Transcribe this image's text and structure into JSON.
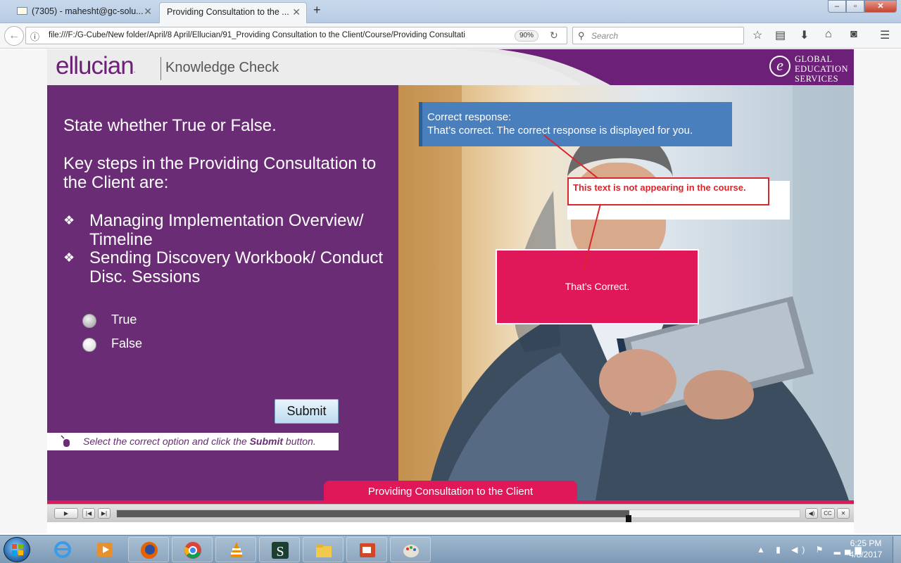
{
  "browser": {
    "tabs": [
      {
        "label": "(7305) - mahesht@gc-solu..."
      },
      {
        "label": "Providing Consultation to the ..."
      }
    ],
    "url": "file:///F:/G-Cube/New folder/April/8 April/Ellucian/91_Providing Consultation to the Client/Course/Providing Consultati",
    "zoom": "90%",
    "search_placeholder": "Search"
  },
  "course": {
    "logo": "ellucian",
    "header_title": "Knowledge Check",
    "partner_logo": {
      "line1": "GLOBAL",
      "line2": "EDUCATION",
      "line3": "SERVICES"
    },
    "question": {
      "instruction": "State whether True or False.",
      "prompt": "Key steps in the Providing Consultation to the Client are:",
      "bullets": [
        "Managing Implementation Overview/ Timeline",
        "Sending Discovery Workbook/ Conduct Disc. Sessions"
      ],
      "options": [
        {
          "label": "True",
          "selected": true
        },
        {
          "label": "False",
          "selected": false
        }
      ],
      "submit_label": "Submit",
      "hint_prefix": "Select the correct option and click the ",
      "hint_bold": "Submit",
      "hint_suffix": " button."
    },
    "correct_response": {
      "title": "Correct response:",
      "text": "That’s correct.  The correct response is displayed for you."
    },
    "review_note": "This text is not appearing in the course.",
    "feedback": "That’s Correct.",
    "footer_title": "Providing Consultation to the Client",
    "accent_color": "#e0185a",
    "panel_color": "#6a2c75"
  },
  "player": {
    "progress_fraction": 0.75,
    "cc_label": "CC"
  },
  "taskbar": {
    "apps": [
      "internet-explorer",
      "media-player",
      "firefox",
      "chrome",
      "vlc",
      "scribe",
      "file-explorer",
      "presentation",
      "paint"
    ],
    "time": "6:25 PM",
    "date": "4/8/2017"
  }
}
